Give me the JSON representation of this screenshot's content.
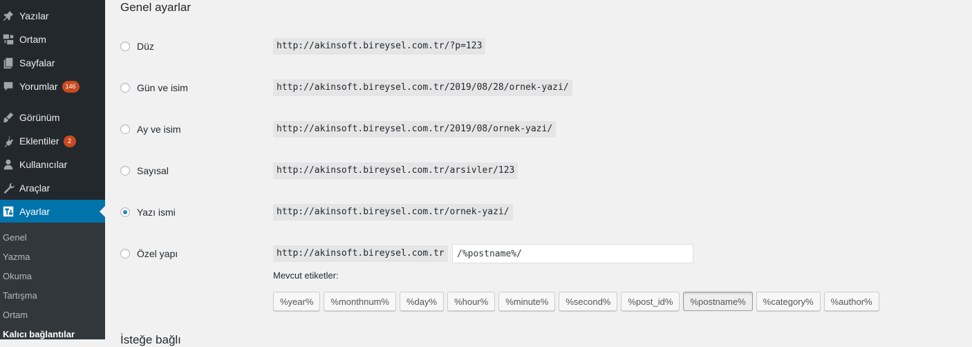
{
  "sidebar": {
    "items": [
      {
        "label": "Yazılar",
        "icon": "pin-icon"
      },
      {
        "label": "Ortam",
        "icon": "media-icon"
      },
      {
        "label": "Sayfalar",
        "icon": "pages-icon"
      },
      {
        "label": "Yorumlar",
        "icon": "comment-icon",
        "badge": "146"
      },
      {
        "label": "Görünüm",
        "icon": "brush-icon"
      },
      {
        "label": "Eklentiler",
        "icon": "plugin-icon",
        "badge": "2"
      },
      {
        "label": "Kullanıcılar",
        "icon": "user-icon"
      },
      {
        "label": "Araçlar",
        "icon": "wrench-icon"
      },
      {
        "label": "Ayarlar",
        "icon": "settings-icon",
        "active": true
      }
    ],
    "submenu": [
      "Genel",
      "Yazma",
      "Okuma",
      "Tartışma",
      "Ortam",
      "Kalıcı bağlantılar"
    ],
    "submenu_current": "Kalıcı bağlantılar",
    "active_color": "#0073aa",
    "badge_color": "#ca4a1f"
  },
  "main": {
    "section_title": "Genel ayarlar",
    "options": [
      {
        "label": "Düz",
        "url": "http://akinsoft.bireysel.com.tr/?p=123",
        "checked": false
      },
      {
        "label": "Gün ve isim",
        "url": "http://akinsoft.bireysel.com.tr/2019/08/28/ornek-yazi/",
        "checked": false
      },
      {
        "label": "Ay ve isim",
        "url": "http://akinsoft.bireysel.com.tr/2019/08/ornek-yazi/",
        "checked": false
      },
      {
        "label": "Sayısal",
        "url": "http://akinsoft.bireysel.com.tr/arsivler/123",
        "checked": false
      },
      {
        "label": "Yazı ismi",
        "url": "http://akinsoft.bireysel.com.tr/ornek-yazi/",
        "checked": true
      },
      {
        "label": "Özel yapı",
        "url": "http://akinsoft.bireysel.com.tr",
        "checked": false
      }
    ],
    "custom_structure_value": "/%postname%/",
    "tags_label": "Mevcut etiketler:",
    "tags": [
      "%year%",
      "%monthnum%",
      "%day%",
      "%hour%",
      "%minute%",
      "%second%",
      "%post_id%",
      "%postname%",
      "%category%",
      "%author%"
    ],
    "active_tag": "%postname%",
    "next_section_title": "İsteğe bağlı"
  }
}
